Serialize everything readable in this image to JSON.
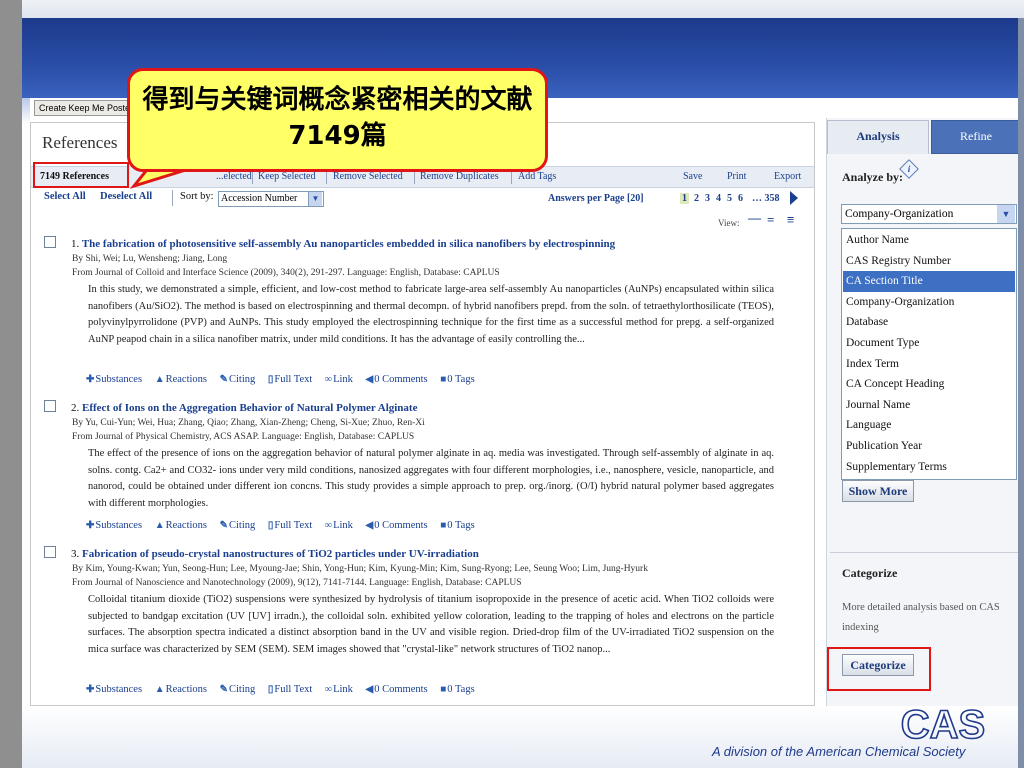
{
  "screen": {
    "callout_text": "得到与关键词概念紧密相关的文献7149篇",
    "footer_text": "A division of the American Chemical Society",
    "logo_text": "CAS"
  },
  "toolbar": {
    "keep_me_posted": "Create Keep Me Posted",
    "references_title": "References",
    "ref_count": "7149 References",
    "actions": [
      "...elected",
      "Keep Selected",
      "Remove Selected",
      "Remove Duplicates",
      "Add Tags"
    ],
    "right_actions": [
      "Save",
      "Print",
      "Export"
    ],
    "select_all": "Select All",
    "deselect_all": "Deselect All",
    "sort_label": "Sort by:",
    "sort_value": "Accession Number",
    "answers_per_page": "Answers per Page [20]",
    "pages": [
      "1",
      "2",
      "3",
      "4",
      "5",
      "6",
      "… 358"
    ],
    "view_label": "View:"
  },
  "results": [
    {
      "num": "1.",
      "title": "The fabrication of photosensitive self-assembly Au nanoparticles embedded in silica nanofibers by electrospinning",
      "authors": "By Shi, Wei; Lu, Wensheng; Jiang, Long",
      "source": "From Journal of Colloid and Interface Science (2009), 340(2), 291-297. Language: English, Database: CAPLUS",
      "abstract": "In this study, we demonstrated a simple, efficient, and low-cost method to fabricate large-area self-assembly Au nanoparticles (AuNPs) encapsulated within silica nanofibers (Au/SiO2). The method is based on electrospinning and thermal decompn. of hybrid nanofibers prepd. from the soln. of tetraethylorthosilicate (TEOS), polyvinylpyrrolidone (PVP) and AuNPs. This study employed the electrospinning technique for the first time as a successful method for prepg. a self-organized AuNP peapod chain in a silica nanofiber matrix, under mild conditions. It has the advantage of easily controlling the..."
    },
    {
      "num": "2.",
      "title": "Effect of Ions on the Aggregation Behavior of Natural Polymer Alginate",
      "authors": "By Yu, Cui-Yun; Wei, Hua; Zhang, Qiao; Zhang, Xian-Zheng; Cheng, Si-Xue; Zhuo, Ren-Xi",
      "source": "From Journal of Physical Chemistry, ACS ASAP. Language: English, Database: CAPLUS",
      "abstract": "The effect of the presence of ions on the aggregation behavior of natural polymer alginate in aq. media was investigated. Through self-assembly of alginate in aq. solns. contg. Ca2+ and CO32- ions under very mild conditions, nanosized aggregates with four different morphologies, i.e., nanosphere, vesicle, nanoparticle, and nanorod, could be obtained under different ion concns. This study provides a simple approach to prep. org./inorg. (O/I) hybrid natural polymer based aggregates with different morphologies."
    },
    {
      "num": "3.",
      "title": "Fabrication of pseudo-crystal nanostructures of TiO2 particles under UV-irradiation",
      "authors": "By Kim, Young-Kwan; Yun, Seong-Hun; Lee, Myoung-Jae; Shin, Yong-Hun; Kim, Kyung-Min; Kim, Sung-Ryong; Lee, Seung Woo; Lim, Jung-Hyurk",
      "source": "From Journal of Nanoscience and Nanotechnology (2009), 9(12), 7141-7144. Language: English, Database: CAPLUS",
      "abstract": "Colloidal titanium dioxide (TiO2) suspensions were synthesized by hydrolysis of titanium isopropoxide in the presence of acetic acid. When TiO2 colloids were subjected to bandgap excitation (UV [UV] irradn.), the colloidal soln. exhibited yellow coloration, leading to the trapping of holes and electrons on the particle surfaces. The absorption spectra indicated a distinct absorption band in the UV and visible region. Dried-drop film of the UV-irradiated TiO2 suspension on the mica surface was characterized by SEM (SEM). SEM images showed that \"crystal-like\" network structures of TiO2 nanop..."
    }
  ],
  "record_links": [
    "Substances",
    "Reactions",
    "Citing",
    "Full Text",
    "Link",
    "0 Comments",
    "0 Tags"
  ],
  "sidebar": {
    "tab_analysis": "Analysis",
    "tab_refine": "Refine",
    "analyze_by": "Analyze by:",
    "selected": "Company-Organization",
    "options": [
      "Author Name",
      "CAS Registry Number",
      "CA Section Title",
      "Company-Organization",
      "Database",
      "Document Type",
      "Index Term",
      "CA Concept Heading",
      "Journal Name",
      "Language",
      "Publication Year",
      "Supplementary Terms"
    ],
    "highlighted_option": "CA Section Title",
    "show_more": "Show More",
    "categorize_title": "Categorize",
    "categorize_desc": "More detailed analysis based on CAS indexing",
    "categorize_button": "Categorize"
  },
  "colors": {
    "accent": "#1a3f8e",
    "annotation_red": "#e01515",
    "callout_fill": "#ffff66",
    "band_blue": "#2a4ea8"
  }
}
